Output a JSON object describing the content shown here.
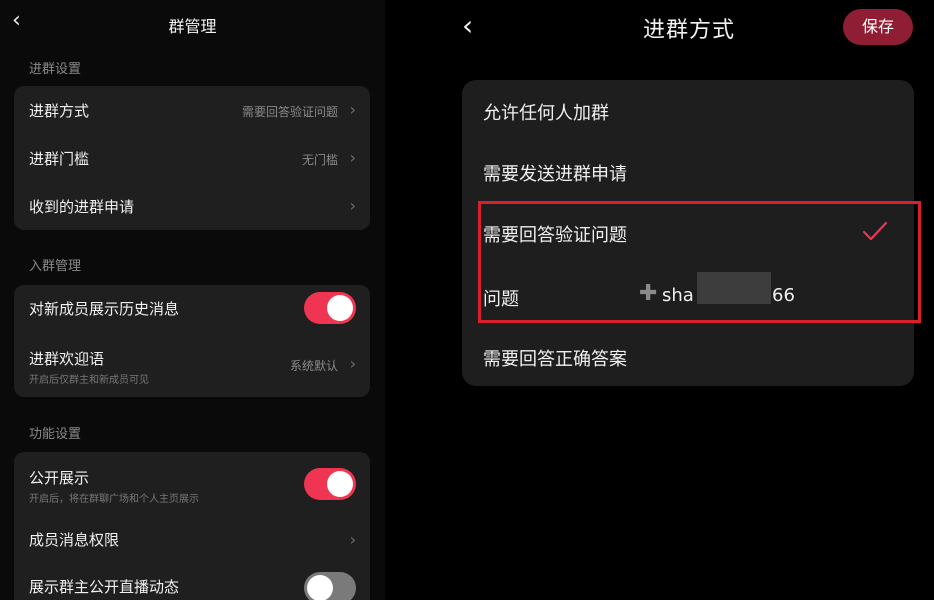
{
  "left": {
    "header": {
      "back_icon": "‹",
      "title": "群管理"
    },
    "sections": [
      {
        "title": "进群设置",
        "rows": [
          {
            "label": "进群方式",
            "value": "需要回答验证问题"
          },
          {
            "label": "进群门槛",
            "value": "无门槛"
          },
          {
            "label": "收到的进群申请",
            "value": ""
          }
        ]
      },
      {
        "title": "入群管理",
        "rows": [
          {
            "label": "对新成员展示历史消息",
            "toggle": "on"
          },
          {
            "label": "进群欢迎语",
            "sub": "开启后仅群主和新成员可见",
            "value": "系统默认"
          }
        ]
      },
      {
        "title": "功能设置",
        "rows": [
          {
            "label": "公开展示",
            "sub": "开启后，将在群聊广场和个人主页展示",
            "toggle": "on"
          },
          {
            "label": "成员消息权限"
          },
          {
            "label": "展示群主公开直播动态",
            "toggle": "off"
          }
        ]
      }
    ],
    "chevron_icon": "›"
  },
  "right": {
    "header": {
      "back_icon": "‹",
      "title": "进群方式",
      "save_label": "保存"
    },
    "options": [
      {
        "label": "允许任何人加群"
      },
      {
        "label": "需要发送进群申请"
      },
      {
        "label": "需要回答验证问题",
        "selected": true
      },
      {
        "label": "需要回答正确答案"
      }
    ],
    "question": {
      "label": "问题",
      "plus_icon": "✚",
      "answer_prefix": "sha",
      "answer_suffix": "66"
    }
  },
  "colors": {
    "accent": "#ef3551",
    "save_button": "#8f1d34",
    "highlight_border": "#d91e2c",
    "card": "#1f1f1f"
  }
}
